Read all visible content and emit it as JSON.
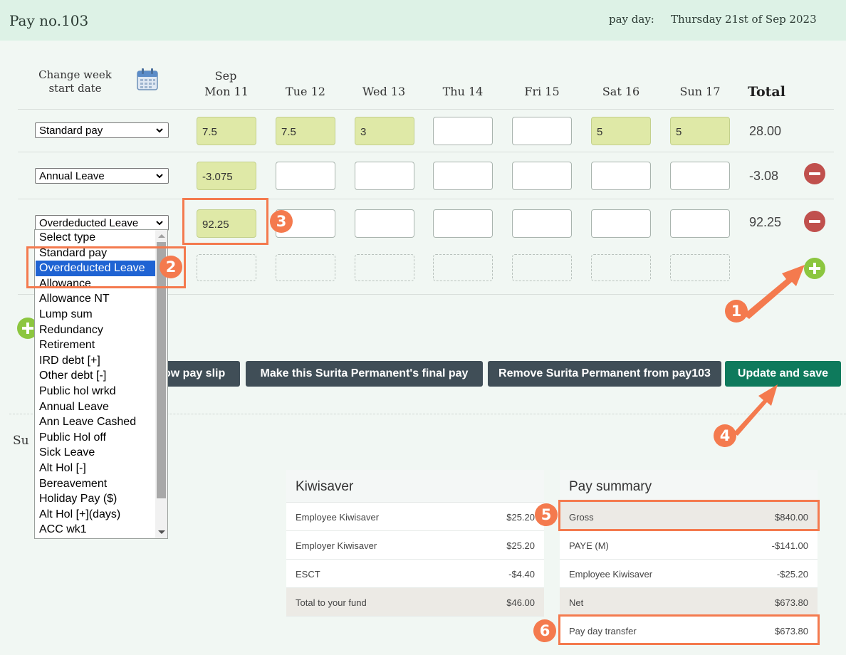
{
  "header": {
    "title": "Pay no.103",
    "payday_label": "pay day:",
    "payday_value": "Thursday 21st of Sep 2023"
  },
  "grid": {
    "change_week_label": "Change week start date",
    "month": "Sep",
    "days": [
      "Mon 11",
      "Tue 12",
      "Wed 13",
      "Thu 14",
      "Fri 15",
      "Sat 16",
      "Sun 17"
    ],
    "total_label": "Total",
    "rows": [
      {
        "type": "Standard pay",
        "cells": [
          "7.5",
          "7.5",
          "3",
          "",
          "",
          "5",
          "5"
        ],
        "total": "28.00",
        "removable": false
      },
      {
        "type": "Annual Leave",
        "cells": [
          "-3.075",
          "",
          "",
          "",
          "",
          "",
          ""
        ],
        "total": "-3.08",
        "removable": true
      },
      {
        "type": "Overdeducted Leave",
        "cells": [
          "92.25",
          "",
          "",
          "",
          "",
          "",
          ""
        ],
        "total": "92.25",
        "removable": true
      }
    ]
  },
  "dropdown": {
    "selected": "Overdeducted Leave",
    "options": [
      "Select type",
      "Standard pay",
      "Overdeducted Leave",
      "Allowance",
      "Allowance NT",
      "Lump sum",
      "Redundancy",
      "Retirement",
      "IRD debt [+]",
      "Other debt [-]",
      "Public hol wrkd",
      "Annual Leave",
      "Ann Leave Cashed",
      "Public Hol off",
      "Sick Leave",
      "Alt Hol [-]",
      "Bereavement",
      "Holiday Pay ($)",
      "Alt Hol [+](days)",
      "ACC wk1"
    ]
  },
  "buttons": {
    "payslip": "ow pay slip",
    "final_pay": "Make this Surita Permanent's final pay",
    "remove": "Remove Surita Permanent from pay103",
    "update": "Update and save"
  },
  "summary_label": "Su",
  "kiwisaver": {
    "title": "Kiwisaver",
    "rows": [
      {
        "label": "Employee Kiwisaver",
        "value": "$25.20"
      },
      {
        "label": "Employer Kiwisaver",
        "value": "$25.20"
      },
      {
        "label": "ESCT",
        "value": "-$4.40"
      },
      {
        "label": "Total to your fund",
        "value": "$46.00"
      }
    ]
  },
  "pay_summary": {
    "title": "Pay summary",
    "rows": [
      {
        "label": "Gross",
        "value": "$840.00"
      },
      {
        "label": "PAYE (M)",
        "value": "-$141.00"
      },
      {
        "label": "Employee Kiwisaver",
        "value": "-$25.20"
      },
      {
        "label": "Net",
        "value": "$673.80"
      },
      {
        "label": "Pay day transfer",
        "value": "$673.80"
      }
    ]
  },
  "badges": [
    "1",
    "2",
    "3",
    "4",
    "5",
    "6"
  ],
  "colors": {
    "accent_orange": "#f47a4e",
    "filled_cell": "#dfe9a7",
    "save_green": "#0e7a5c",
    "dark_button": "#404e57",
    "header_bg": "#ddf2e6"
  },
  "icons": [
    "calendar-icon",
    "minus-circle-icon",
    "plus-circle-icon",
    "arrow-icon",
    "chevron-down-icon"
  ]
}
